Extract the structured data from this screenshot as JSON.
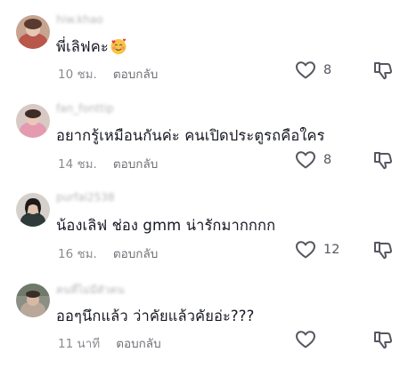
{
  "colors": {
    "text": "#161823",
    "meta": "#8a8b91",
    "icon": "#555660",
    "username_blurred": "#b8b8bd"
  },
  "comments": [
    {
      "username": "hiw.khao",
      "text": "พี่เลิฟคะ",
      "emoji": "smiling-face-with-hearts-icon",
      "time": "10 ชม.",
      "reply_label": "ตอบกลับ",
      "like_count": "8"
    },
    {
      "username": "fan_fonttip",
      "text": "อยากรู้เหมือนกันค่ะ คนเปิดประตูรถคือใคร",
      "time": "14 ชม.",
      "reply_label": "ตอบกลับ",
      "like_count": "8"
    },
    {
      "username": "purfai2538",
      "text": "น้องเลิฟ ช่อง gmm น่ารักมากกกก",
      "time": "16 ชม.",
      "reply_label": "ตอบกลับ",
      "like_count": "12"
    },
    {
      "username": "คนที่ไม่มีตัวตน",
      "text": "ออๆนึกแล้ว ว่าคัยแล้วคัยอ่ะ???",
      "time": "11 นาที",
      "reply_label": "ตอบกลับ",
      "like_count": ""
    }
  ]
}
